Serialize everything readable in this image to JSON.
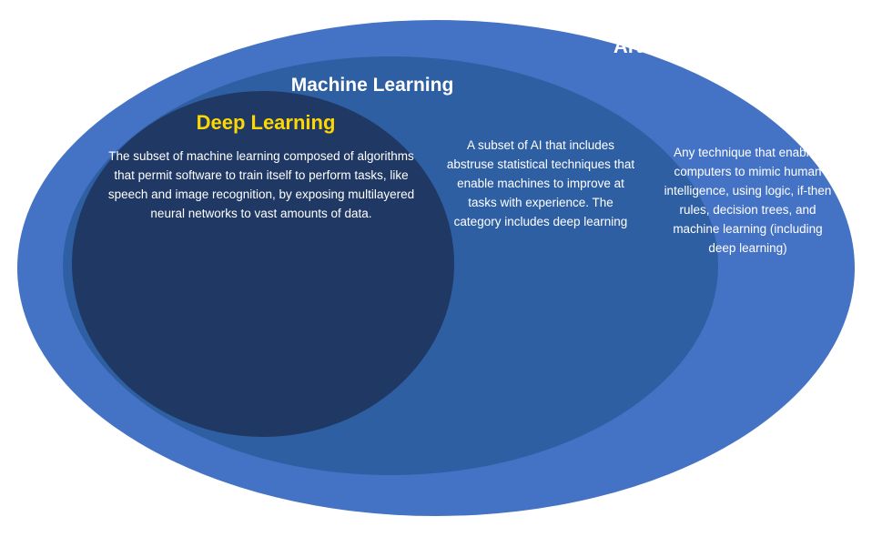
{
  "diagram": {
    "ai_title": "Artificial Intelligence",
    "ml_title": "Machine Learning",
    "dl_title": "Deep Learning",
    "dl_description": "The subset of machine learning composed of algorithms that permit software to train itself to perform tasks, like speech and image recognition, by exposing multilayered neural networks to vast amounts of data.",
    "ml_description": "A subset of AI that includes abstruse statistical techniques that enable machines to improve at tasks with experience. The category includes deep learning",
    "ai_description": "Any technique that enables computers to mimic human intelligence, using logic, if-then rules, decision trees, and machine learning (including deep learning)",
    "colors": {
      "ai_bg": "#4472C4",
      "ml_bg": "#2E5FA3",
      "dl_bg": "#1F3864",
      "dl_title_color": "#FFD700",
      "text_color": "#ffffff"
    }
  }
}
